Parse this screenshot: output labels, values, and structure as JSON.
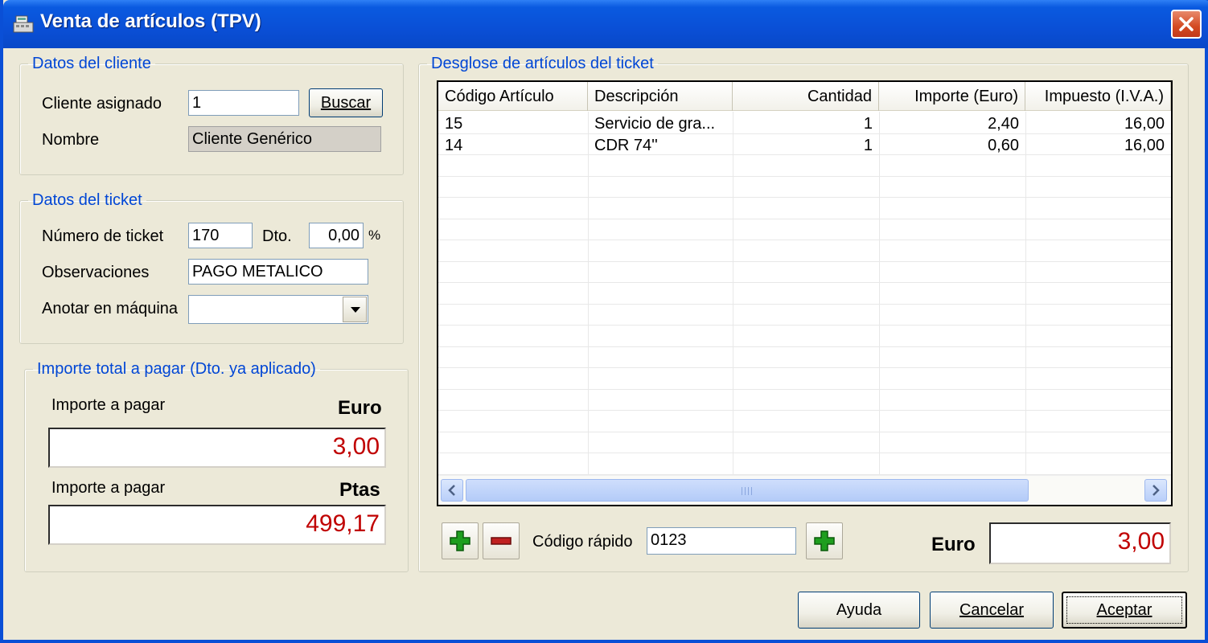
{
  "window": {
    "title": "Venta de artículos (TPV)"
  },
  "cliente": {
    "legend": "Datos del cliente",
    "asignado_label": "Cliente asignado",
    "asignado_value": "1",
    "buscar_label": "Buscar",
    "nombre_label": "Nombre",
    "nombre_value": "Cliente Genérico"
  },
  "ticket": {
    "legend": "Datos del ticket",
    "numero_label": "Número de ticket",
    "numero_value": "170",
    "dto_label": "Dto.",
    "dto_value": "0,00",
    "dto_unit": "%",
    "observaciones_label": "Observaciones",
    "observaciones_value": "PAGO METALICO",
    "maquina_label": "Anotar en máquina",
    "maquina_value": ""
  },
  "importe": {
    "legend": "Importe total a pagar (Dto. ya aplicado)",
    "euro_label": "Importe a pagar",
    "euro_currency": "Euro",
    "euro_value": "3,00",
    "ptas_label": "Importe a pagar",
    "ptas_currency": "Ptas",
    "ptas_value": "499,17"
  },
  "desglose": {
    "legend": "Desglose de artículos del ticket",
    "columns": [
      "Código Artículo",
      "Descripción",
      "Cantidad",
      "Importe (Euro)",
      "Impuesto (I.V.A.)"
    ],
    "rows": [
      [
        "15",
        "Servicio de gra...",
        "1",
        "2,40",
        "16,00"
      ],
      [
        "14",
        "CDR 74''",
        "1",
        "0,60",
        "16,00"
      ]
    ],
    "codigo_rapido_label": "Código rápido",
    "codigo_rapido_value": "0123",
    "total_currency": "Euro",
    "total_value": "3,00"
  },
  "buttons": {
    "ayuda": "Ayuda",
    "cancelar": "Cancelar",
    "aceptar": "Aceptar"
  },
  "colors": {
    "accent": "#0046d5",
    "amount": "#c00000",
    "titlebar": "#0a4fd6"
  }
}
